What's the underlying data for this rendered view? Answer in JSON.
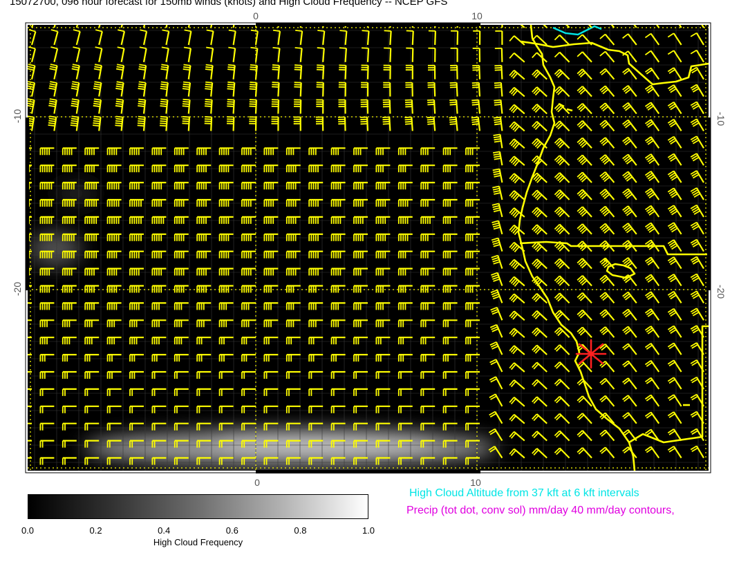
{
  "title": "15072700, 096 hour forecast for 150mb winds (knots) and High Cloud Frequency -- NCEP GFS",
  "axes": {
    "lon_ticks_top": [
      "0",
      "10"
    ],
    "lon_ticks_bottom": [
      "0",
      "10"
    ],
    "lat_ticks_left": [
      "-10",
      "-20"
    ],
    "lat_ticks_right": [
      "-10",
      "-20"
    ],
    "lon_range": [
      -10.5,
      20
    ],
    "lat_range": [
      -30.5,
      -4.5
    ]
  },
  "colorbar": {
    "label": "High Cloud Frequency",
    "ticks": [
      "0.0",
      "0.2",
      "0.4",
      "0.6",
      "0.8",
      "1.0"
    ],
    "range": [
      0.0,
      1.0
    ]
  },
  "legend": {
    "cloud_altitude": "High Cloud Altitude from 37 kft at 6 kft intervals",
    "precip": "Precip (tot dot, conv sol) mm/day 40 mm/day contours,"
  },
  "colors": {
    "background": "#000000",
    "wind_barbs": "#ffff00",
    "coastline": "#ffff00",
    "cloud_contour": "#00e5e5",
    "precip_text": "#e000e0",
    "marker": "#ff2020"
  },
  "marker": {
    "icon": "star-marker-icon",
    "lon": 14.8,
    "lat": -22.9
  },
  "wind_field": {
    "units": "knots",
    "level": "150mb"
  }
}
